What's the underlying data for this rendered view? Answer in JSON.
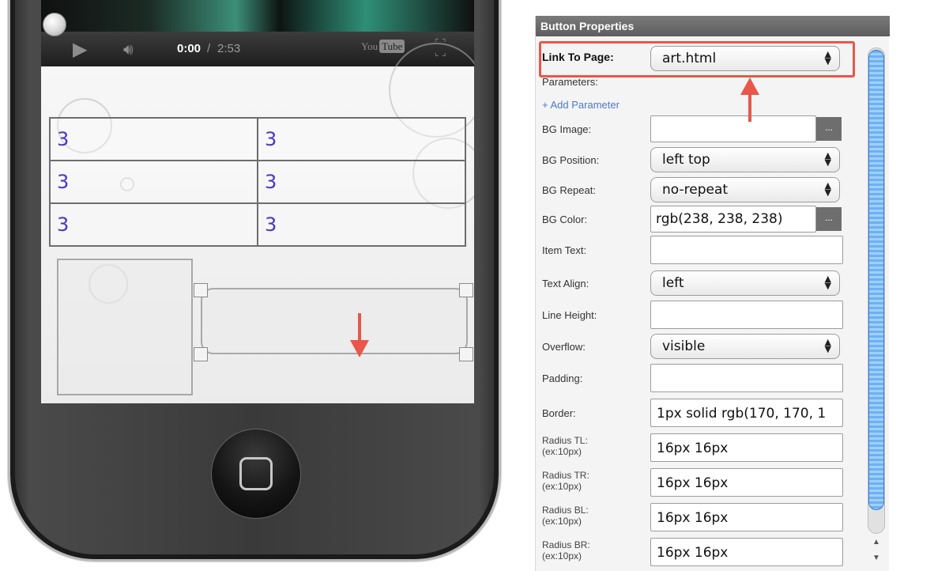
{
  "video_player": {
    "current_time": "0:00",
    "separator": "/",
    "total_time": "2:53",
    "youtube_logo_you": "You",
    "youtube_logo_tube": "Tube"
  },
  "table_cells": [
    [
      "3",
      "3"
    ],
    [
      "3",
      "3"
    ],
    [
      "3",
      "3"
    ]
  ],
  "panel": {
    "title": "Button Properties",
    "link_label": "Link To Page:",
    "link_value": "art.html",
    "parameters_label": "Parameters:",
    "add_parameter": "+ Add Parameter",
    "bg_image_label": "BG Image:",
    "bg_image_value": "",
    "browse_label": "...",
    "bg_position_label": "BG Position:",
    "bg_position_value": "left top",
    "bg_repeat_label": "BG Repeat:",
    "bg_repeat_value": "no-repeat",
    "bg_color_label": "BG Color:",
    "bg_color_value": "rgb(238, 238, 238)",
    "item_text_label": "Item Text:",
    "item_text_value": "",
    "text_align_label": "Text Align:",
    "text_align_value": "left",
    "line_height_label": "Line Height:",
    "line_height_value": "",
    "overflow_label": "Overflow:",
    "overflow_value": "visible",
    "padding_label": "Padding:",
    "padding_value": "",
    "border_label": "Border:",
    "border_value": "1px solid rgb(170, 170, 1",
    "radius_tl_label": "Radius TL:",
    "radius_tr_label": "Radius TR:",
    "radius_bl_label": "Radius BL:",
    "radius_br_label": "Radius BR:",
    "radius_hint": "(ex:10px)",
    "radius_tl_value": "16px 16px",
    "radius_tr_value": "16px 16px",
    "radius_bl_value": "16px 16px",
    "radius_br_value": "16px 16px"
  },
  "colors": {
    "highlight": "#e8574a",
    "link_blue": "#4f78c6",
    "cell_text": "#4a36c6",
    "scroll_thumb": "#6fb0f2"
  },
  "icons": [
    "play-icon",
    "volume-icon",
    "youtube-logo",
    "fullscreen-icon",
    "home-button-icon",
    "select-arrows-icon",
    "down-arrow-icon",
    "up-arrow-icon"
  ]
}
